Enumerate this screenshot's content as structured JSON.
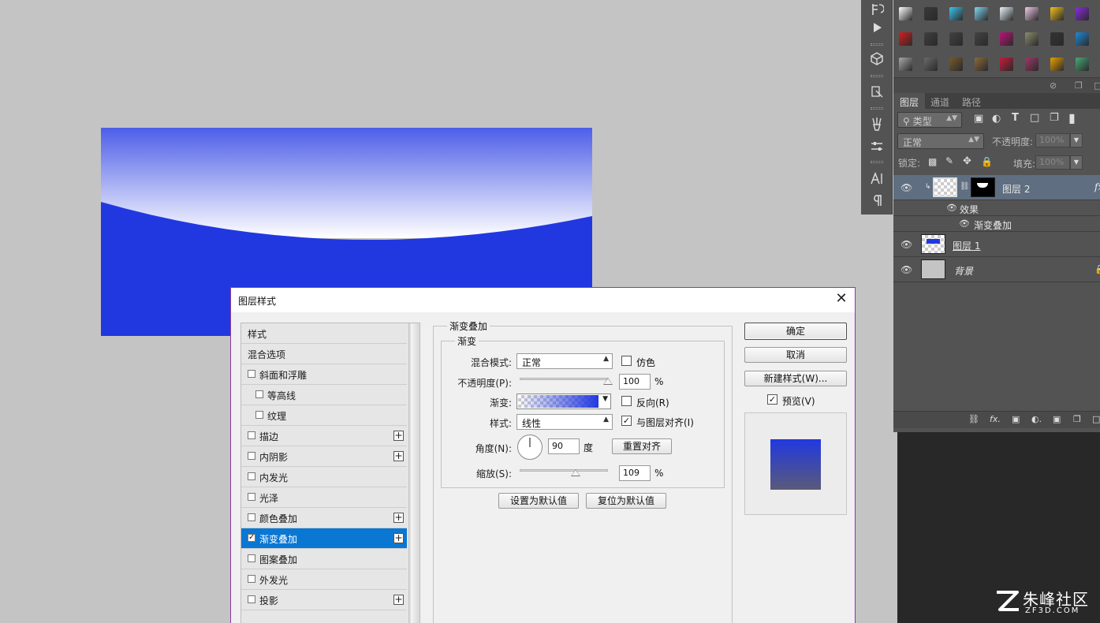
{
  "canvas": {
    "top_gradient": [
      "#4d5ee8",
      "#ffffff"
    ],
    "fill_color": "#2138e0"
  },
  "colors": {
    "app_bg": "#c4c4c4",
    "panel_bg": "#535353",
    "selected_blue": "#0a77d3",
    "dialog_border": "#8a3aa4",
    "gradient_blue": "#2138e0"
  },
  "tool_strip": {
    "icons": [
      "history-icon",
      "play-action-icon",
      "3d-icon",
      "properties-icon",
      "brush-preset-icon",
      "adjust-icon",
      "character-icon",
      "paragraph-icon"
    ]
  },
  "swatch_panel": {
    "swatches": [
      [
        "#ffffff",
        "#3a3a3a",
        "#3bc4ee",
        "#7fd6f0",
        "#e8f4fb",
        "#f0c8e8",
        "#f2c01a",
        "#8a2be2"
      ],
      [
        "#d81c1c",
        "#3f3f3f",
        "#424242",
        "#444444",
        "#c0107a",
        "#8c8c70",
        "#333333",
        "#1c8ad8"
      ],
      [
        "#a8a8a8",
        "#6a6a6a",
        "#7a5a2a",
        "#8a6a3a",
        "#c81a3a",
        "#a0386a",
        "#e8a000",
        "#4aa878"
      ]
    ]
  },
  "layers_panel": {
    "tabs": [
      "图层",
      "通道",
      "路径"
    ],
    "active_tab": "图层",
    "filter_kind": "类型",
    "blend_mode": "正常",
    "opacity_label": "不透明度:",
    "opacity_value": "100%",
    "lock_label": "锁定:",
    "fill_label": "填充:",
    "fill_value": "100%",
    "fx_badge": "fx",
    "layers": [
      {
        "name": "图层 2",
        "selected": true,
        "effects_label": "效果",
        "effect_item": "渐变叠加"
      },
      {
        "name": "图层 1",
        "selected": false
      },
      {
        "name": "背景",
        "selected": false
      }
    ]
  },
  "dialog": {
    "title": "图层样式",
    "style_list": [
      {
        "label": "样式",
        "has_checkbox": false,
        "checked": false,
        "has_plus": false,
        "indent": 0
      },
      {
        "label": "混合选项",
        "has_checkbox": false,
        "checked": false,
        "has_plus": false,
        "indent": 0
      },
      {
        "label": "斜面和浮雕",
        "has_checkbox": true,
        "checked": false,
        "has_plus": false,
        "indent": 0
      },
      {
        "label": "等高线",
        "has_checkbox": true,
        "checked": false,
        "has_plus": false,
        "indent": 1
      },
      {
        "label": "纹理",
        "has_checkbox": true,
        "checked": false,
        "has_plus": false,
        "indent": 1
      },
      {
        "label": "描边",
        "has_checkbox": true,
        "checked": false,
        "has_plus": true,
        "indent": 0
      },
      {
        "label": "内阴影",
        "has_checkbox": true,
        "checked": false,
        "has_plus": true,
        "indent": 0
      },
      {
        "label": "内发光",
        "has_checkbox": true,
        "checked": false,
        "has_plus": false,
        "indent": 0
      },
      {
        "label": "光泽",
        "has_checkbox": true,
        "checked": false,
        "has_plus": false,
        "indent": 0
      },
      {
        "label": "颜色叠加",
        "has_checkbox": true,
        "checked": false,
        "has_plus": true,
        "indent": 0
      },
      {
        "label": "渐变叠加",
        "has_checkbox": true,
        "checked": true,
        "has_plus": true,
        "indent": 0,
        "selected": true
      },
      {
        "label": "图案叠加",
        "has_checkbox": true,
        "checked": false,
        "has_plus": false,
        "indent": 0
      },
      {
        "label": "外发光",
        "has_checkbox": true,
        "checked": false,
        "has_plus": false,
        "indent": 0
      },
      {
        "label": "投影",
        "has_checkbox": true,
        "checked": false,
        "has_plus": true,
        "indent": 0
      }
    ],
    "section_title": "渐变叠加",
    "group_title": "渐变",
    "blend_mode_label": "混合模式:",
    "blend_mode_value": "正常",
    "dither_label": "仿色",
    "dither_checked": false,
    "opacity_label": "不透明度(P):",
    "opacity_value": "100",
    "opacity_fraction": 1.0,
    "percent": "%",
    "gradient_label": "渐变:",
    "reverse_label": "反向(R)",
    "reverse_checked": false,
    "style_label": "样式:",
    "style_value": "线性",
    "align_label": "与图层对齐(I)",
    "align_checked": true,
    "angle_label": "角度(N):",
    "angle_value": "90",
    "angle_deg": 90,
    "degree_unit": "度",
    "reset_align_button": "重置对齐",
    "scale_label": "缩放(S):",
    "scale_value": "109",
    "scale_fraction": 0.63,
    "make_default_button": "设置为默认值",
    "reset_default_button": "复位为默认值",
    "ok_button": "确定",
    "cancel_button": "取消",
    "new_style_button": "新建样式(W)...",
    "preview_label": "预览(V)",
    "preview_checked": true,
    "preview_gradient": [
      "#2138e0",
      "#5a5a7a"
    ]
  },
  "watermark": {
    "name": "朱峰社区",
    "site": "ZF3D.COM"
  }
}
